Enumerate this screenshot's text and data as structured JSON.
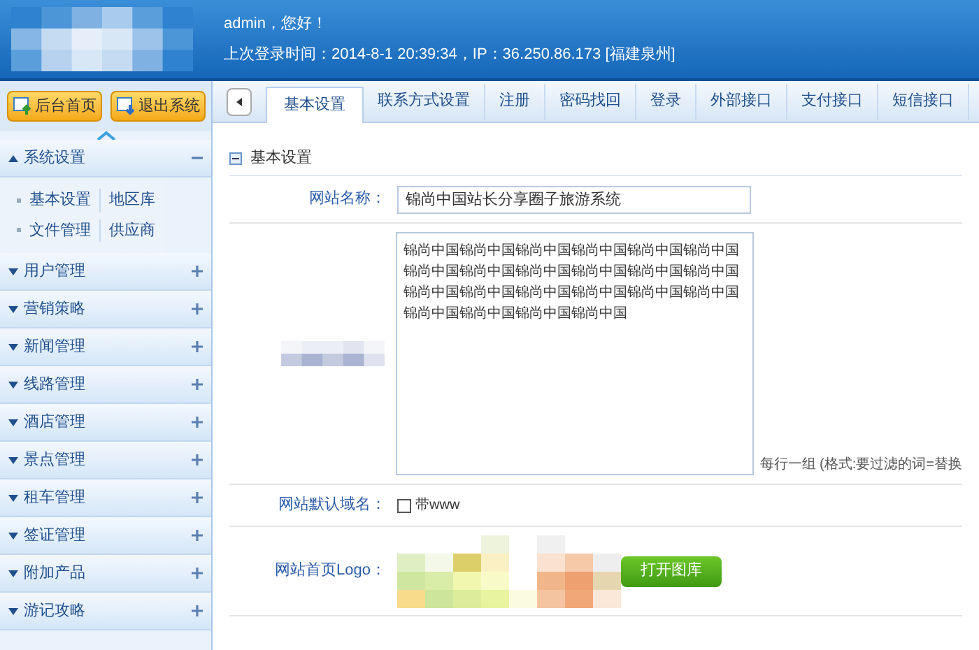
{
  "header": {
    "greeting": "admin，您好！",
    "last_login": "上次登录时间：2014-8-1 20:39:34，IP：36.250.86.173 [福建泉州]"
  },
  "sidebar": {
    "buttons": [
      "后台首页",
      "退出系统"
    ],
    "sections": [
      {
        "label": "系统设置",
        "expanded": true,
        "children": [
          {
            "label": "基本设置"
          },
          {
            "label": "地区库"
          },
          {
            "label": "文件管理"
          },
          {
            "label": "供应商"
          }
        ]
      },
      {
        "label": "用户管理",
        "expanded": false
      },
      {
        "label": "营销策略",
        "expanded": false
      },
      {
        "label": "新闻管理",
        "expanded": false
      },
      {
        "label": "线路管理",
        "expanded": false
      },
      {
        "label": "酒店管理",
        "expanded": false
      },
      {
        "label": "景点管理",
        "expanded": false
      },
      {
        "label": "租车管理",
        "expanded": false
      },
      {
        "label": "签证管理",
        "expanded": false
      },
      {
        "label": "附加产品",
        "expanded": false
      },
      {
        "label": "游记攻略",
        "expanded": false
      }
    ]
  },
  "tabs": [
    {
      "label": "基本设置",
      "selected": true
    },
    {
      "label": "联系方式设置",
      "selected": false
    },
    {
      "label": "注册",
      "selected": false
    },
    {
      "label": "密码找回",
      "selected": false
    },
    {
      "label": "登录",
      "selected": false
    },
    {
      "label": "外部接口",
      "selected": false
    },
    {
      "label": "支付接口",
      "selected": false
    },
    {
      "label": "短信接口",
      "selected": false
    }
  ],
  "section_title": "基本设置",
  "form": {
    "site_name": {
      "label": "网站名称：",
      "value": "锦尚中国站长分享圈子旅游系统"
    },
    "filter_words": {
      "value": "锦尚中国锦尚中国锦尚中国锦尚中国锦尚中国锦尚中国锦尚中国锦尚中国锦尚中国锦尚中国锦尚中国锦尚中国锦尚中国锦尚中国锦尚中国锦尚中国锦尚中国锦尚中国锦尚中国锦尚中国锦尚中国锦尚中国",
      "hint": "每行一组 (格式:要过滤的词=替换"
    },
    "default_domain": {
      "label": "网站默认域名：",
      "checked": false,
      "option": "带www"
    },
    "logo": {
      "label": "网站首页Logo：",
      "button": "打开图库"
    }
  }
}
